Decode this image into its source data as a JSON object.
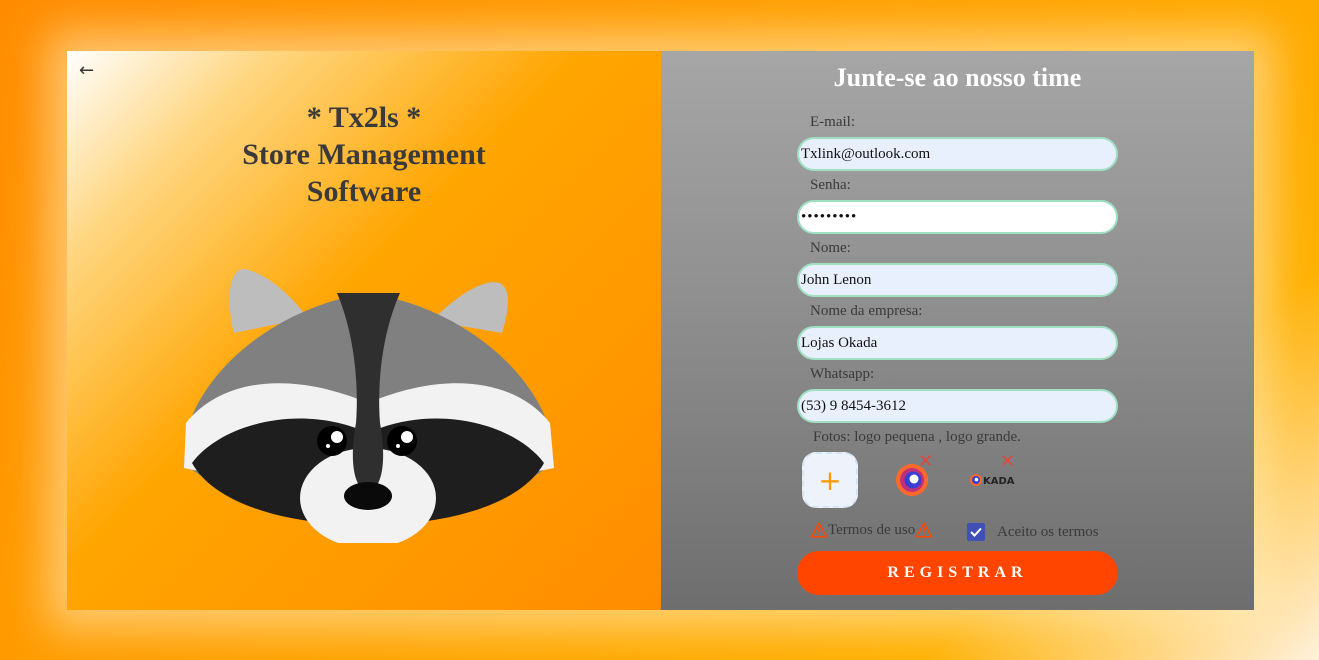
{
  "brand": {
    "line1": "* Tx2ls *",
    "line2": "Store Management",
    "line3": "Software"
  },
  "nav": {
    "back_icon": "arrow-left-icon"
  },
  "form": {
    "title": "Junte-se ao nosso time",
    "email_label": "E-mail:",
    "email_value": "Txlink@outlook.com",
    "password_label": "Senha:",
    "password_value": "123456789",
    "name_label": "Nome:",
    "name_value": "John Lenon",
    "company_label": "Nome da empresa:",
    "company_value": "Lojas Okada",
    "whatsapp_label": "Whatsapp:",
    "whatsapp_value": "(53) 9 8454-3612",
    "photos_label": "Fotos: logo pequena , logo grande.",
    "add_photo": "+",
    "logo_text": "KADA",
    "terms_label": "Termos de uso",
    "accept_label": "Aceito os termos",
    "accept_checked": true,
    "register_label": "REGISTRAR"
  },
  "colors": {
    "accent": "#ff4500",
    "checkbox": "#3f51b5",
    "input_border": "#9fe0c3",
    "remove": "#e0473f"
  }
}
